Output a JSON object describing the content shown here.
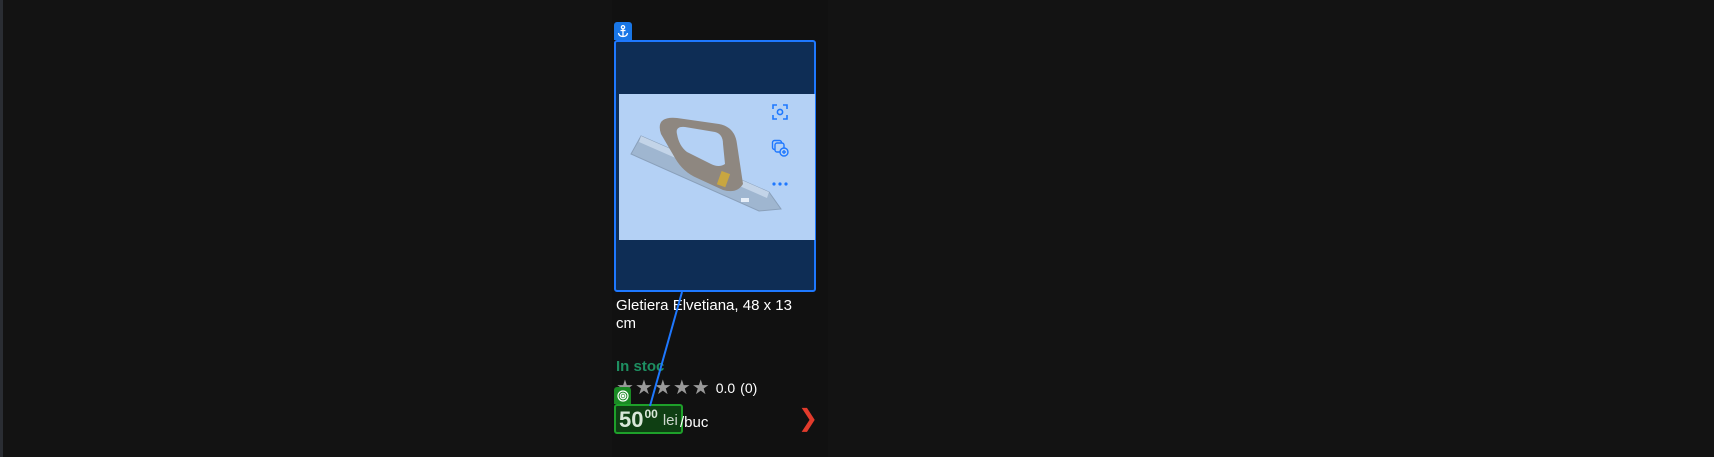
{
  "product": {
    "title": "Gletiera Elvetiana, 48 x 13 cm",
    "stock_status": "In stoc",
    "rating": {
      "stars_filled": 0,
      "stars_total": 5,
      "value": "0.0",
      "count": "(0)"
    },
    "price": {
      "integer": "50",
      "decimals": "00",
      "currency": "lei",
      "unit": "/buc"
    },
    "image_alt": "Gletiera Elvetiana"
  },
  "icons": {
    "anchor_badge": "anchor-icon",
    "target_badge": "target-icon",
    "zoom_action": "scan-icon",
    "compare_action": "add-compare-icon",
    "more_action": "more-dots-icon",
    "next": "chevron-right-icon"
  },
  "colors": {
    "page_background": "#131313",
    "anchor_blue": "#1976e6",
    "frame_border_blue": "#1e78ff",
    "frame_fill": "#0e2d55",
    "stock_green": "#1e8f61",
    "price_border_green": "#1ea02a",
    "next_arrow_red": "#e23b2c",
    "star_grey": "#9a9a9a"
  }
}
